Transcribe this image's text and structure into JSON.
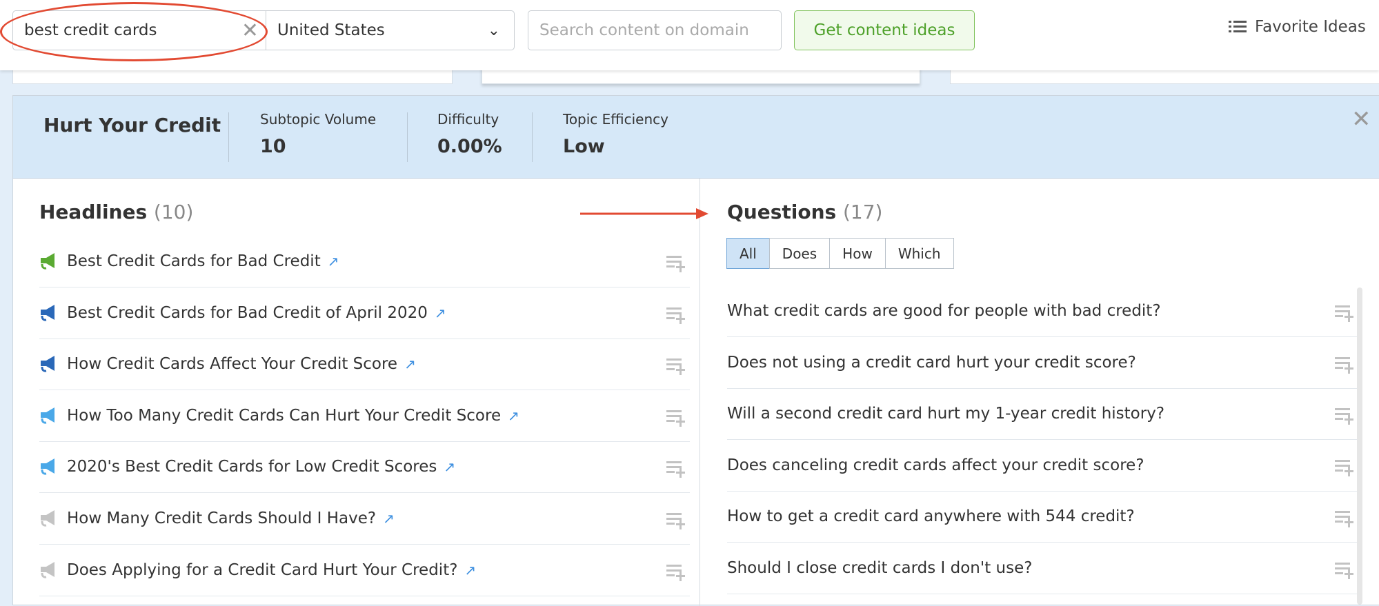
{
  "toolbar": {
    "keyword": "best credit cards",
    "country": "United States",
    "domain_placeholder": "Search content on domain",
    "get_ideas": "Get content ideas",
    "favorite": "Favorite Ideas"
  },
  "topic": {
    "title": "Hurt Your Credit",
    "stats": [
      {
        "label": "Subtopic Volume",
        "value": "10"
      },
      {
        "label": "Difficulty",
        "value": "0.00%"
      },
      {
        "label": "Topic Efficiency",
        "value": "Low"
      }
    ]
  },
  "headlines": {
    "title": "Headlines",
    "count": "(10)",
    "items": [
      {
        "text": "Best Credit Cards for Bad Credit",
        "icon_color": "#5aaa32"
      },
      {
        "text": "Best Credit Cards for Bad Credit of April 2020",
        "icon_color": "#2a68b8"
      },
      {
        "text": "How Credit Cards Affect Your Credit Score",
        "icon_color": "#2a68b8"
      },
      {
        "text": "How Too Many Credit Cards Can Hurt Your Credit Score",
        "icon_color": "#4aa8e8"
      },
      {
        "text": "2020's Best Credit Cards for Low Credit Scores",
        "icon_color": "#4aa8e8"
      },
      {
        "text": "How Many Credit Cards Should I Have?",
        "icon_color": "#c4c4c4"
      },
      {
        "text": "Does Applying for a Credit Card Hurt Your Credit?",
        "icon_color": "#c4c4c4"
      }
    ]
  },
  "questions": {
    "title": "Questions",
    "count": "(17)",
    "filters": [
      "All",
      "Does",
      "How",
      "Which"
    ],
    "active_filter": "All",
    "items": [
      "What credit cards are good for people with bad credit?",
      "Does not using a credit card hurt your credit score?",
      "Will a second credit card hurt my 1-year credit history?",
      "Does canceling credit cards affect your credit score?",
      "How to get a credit card anywhere with 544 credit?",
      "Should I close credit cards I don't use?"
    ]
  },
  "colors": {
    "annotation": "#e24a32",
    "accent": "#4ea12a",
    "header_bg": "#d6e8f8"
  }
}
